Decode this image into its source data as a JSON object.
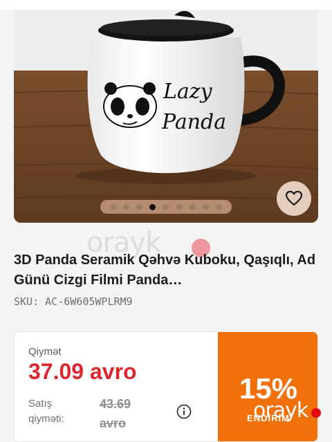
{
  "product": {
    "title": "3D Panda Seramik Qəhvə Kuboku, Qaşıqlı, Ad Günü Cizgi Filmi Panda…",
    "sku": "SKU: AC-6W605WPLRM9",
    "mug_print_line1": "Lazy",
    "mug_print_line2": "Panda"
  },
  "gallery": {
    "dot_count": 9,
    "active_index": 3,
    "favorite_icon": "heart-outline-icon"
  },
  "pricing": {
    "price_label": "Qiymət",
    "price_value": "37.09 avro",
    "sale_label": "Satış qiyməti:",
    "old_price": "43.69 avro",
    "info_icon": "info-circle-icon",
    "discount_percent": "15%",
    "discount_word": "ENDİRİM"
  },
  "watermark": {
    "text": "orayk"
  },
  "colors": {
    "price_red": "#d9282f",
    "discount_orange": "#f0700a",
    "watermark_red": "#e30613"
  }
}
